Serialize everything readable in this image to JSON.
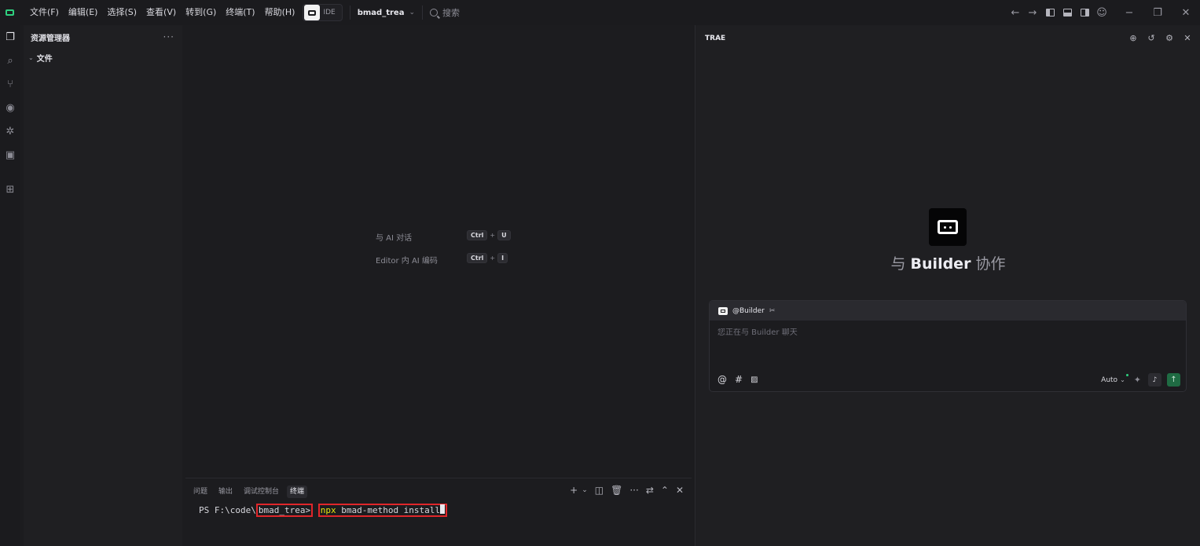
{
  "titlebar": {
    "menus": [
      "文件(F)",
      "编辑(E)",
      "选择(S)",
      "查看(V)",
      "转到(G)",
      "终端(T)",
      "帮助(H)"
    ],
    "mode_label": "IDE",
    "project": "bmad_trea",
    "search_label": "搜索"
  },
  "activity": {
    "icons": [
      "explorer-icon",
      "search-icon",
      "source-control-icon",
      "preview-icon",
      "debug-icon",
      "remote-icon",
      "extensions-icon"
    ]
  },
  "explorer": {
    "title": "资源管理器",
    "more": "···",
    "folder": "文件"
  },
  "editor": {
    "hints": [
      {
        "label": "与 AI 对话",
        "keys": [
          "Ctrl",
          "U"
        ]
      },
      {
        "label": "Editor 内 AI 编码",
        "keys": [
          "Ctrl",
          "I"
        ]
      }
    ],
    "plus": "+"
  },
  "panel": {
    "tabs": [
      "问题",
      "输出",
      "调试控制台",
      "终端"
    ],
    "active_tab": "终端",
    "terminal": {
      "prefix": "PS F:\\code\\",
      "dir": "bmad_trea",
      "prompt": ">",
      "cmd": "npx",
      "args": " bmad-method install"
    }
  },
  "ai": {
    "header": "TRAE",
    "title_prefix": "与 ",
    "title_bold": "Builder",
    "title_suffix": " 协作",
    "agent_name": "@Builder",
    "placeholder": "您正在与 Builder 聊天",
    "model": "Auto"
  },
  "colors": {
    "accent_green": "#2fd07f",
    "highlight_red": "#e0262a",
    "npx_yellow": "#e5e510",
    "send_green": "#1f6b43"
  }
}
